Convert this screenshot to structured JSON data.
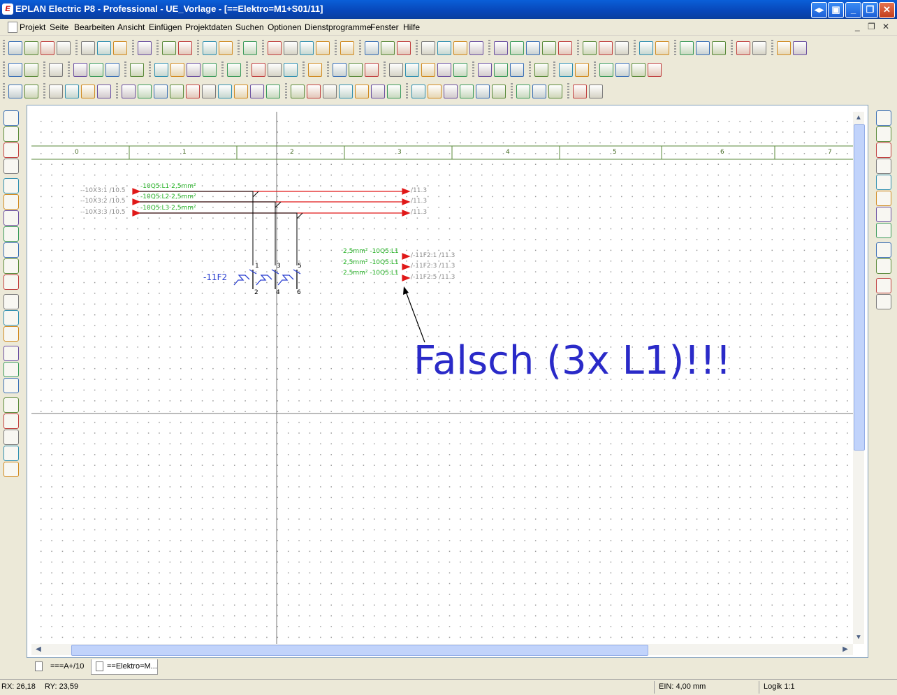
{
  "window": {
    "title": "EPLAN Electric P8 - Professional - UE_Vorlage - [==Elektro=M1+S01/11]",
    "app_icon": "eplan-app-icon"
  },
  "menu": {
    "items": [
      "Projekt",
      "Seite",
      "Bearbeiten",
      "Ansicht",
      "Einfügen",
      "Projektdaten",
      "Suchen",
      "Optionen",
      "Dienstprogramme",
      "Fenster",
      "Hilfe"
    ]
  },
  "schematic": {
    "columns": [
      "0",
      "1",
      "2",
      "3",
      "4",
      "5",
      "6",
      "7"
    ],
    "sources": [
      {
        "origin": "--10X3:1 /10.5",
        "label": "-10Q5:L1 2,5mm²",
        "target": "/11.3"
      },
      {
        "origin": "--10X3:2 /10.5",
        "label": "-10Q5:L2 2,5mm²",
        "target": "/11.3"
      },
      {
        "origin": "--10X3:3 /10.5",
        "label": "-10Q5:L3 2,5mm²",
        "target": "/11.3"
      }
    ],
    "device": {
      "name": "-11F2",
      "pins_top": [
        "1",
        "3",
        "5"
      ],
      "pins_bottom": [
        "2",
        "4",
        "6"
      ]
    },
    "references": [
      {
        "label": "2,5mm² -10Q5:L1",
        "target": "/-11F2:1 /11.3"
      },
      {
        "label": "2,5mm² -10Q5:L1",
        "target": "/-11F2:3 /11.3"
      },
      {
        "label": "2,5mm² -10Q5:L1",
        "target": "/-11F2:5 /11.3"
      }
    ],
    "annotation": "Falsch (3x L1)!!!",
    "colors": {
      "wire_red": "#e01818",
      "text_green": "#21b021",
      "symbol_blue": "#2a3fd0",
      "annotation_blue": "#2a2ac8"
    }
  },
  "tabs": [
    {
      "label": "===A+/10",
      "active": false
    },
    {
      "label": "==Elektro=M...",
      "active": true
    }
  ],
  "status": {
    "rx": "RX: 26,18",
    "ry": "RY: 23,59",
    "ein": "EIN: 4,00 mm",
    "logik": "Logik 1:1"
  }
}
